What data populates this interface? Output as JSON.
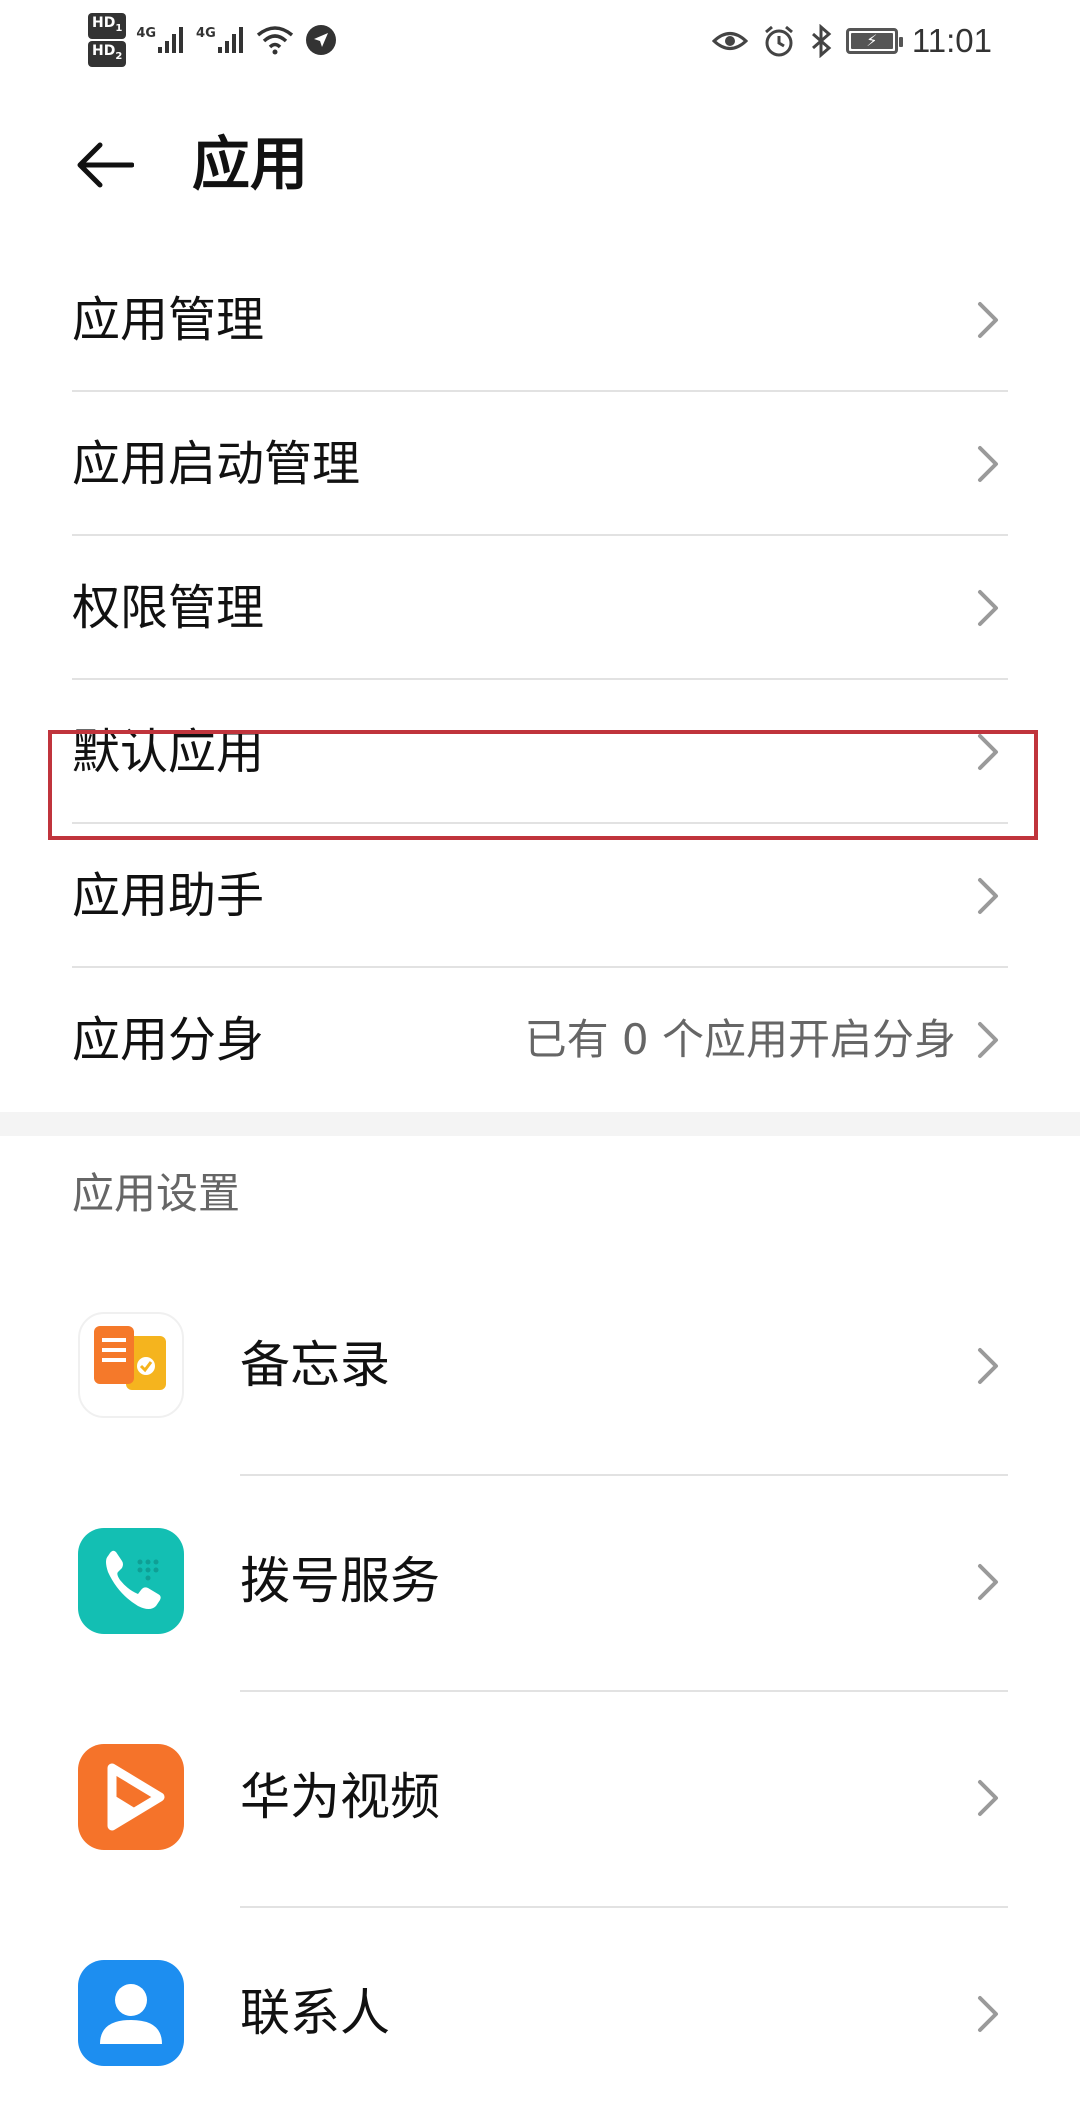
{
  "status_bar": {
    "hd1": "HD",
    "hd1_sub": "1",
    "hd2": "HD",
    "hd2_sub": "2",
    "net1": "4G",
    "net2": "4G",
    "time": "11:01",
    "icons": [
      "eye-icon",
      "alarm-icon",
      "bluetooth-icon",
      "battery-charging-icon",
      "wifi-icon",
      "signal-icon",
      "location-icon"
    ]
  },
  "header": {
    "title": "应用"
  },
  "menu": {
    "items": [
      {
        "label": "应用管理"
      },
      {
        "label": "应用启动管理"
      },
      {
        "label": "权限管理"
      },
      {
        "label": "默认应用"
      },
      {
        "label": "应用助手"
      },
      {
        "label": "应用分身",
        "value": "已有 0 个应用开启分身"
      }
    ]
  },
  "app_settings": {
    "title": "应用设置",
    "apps": [
      {
        "name": "备忘录",
        "icon": "memo-app-icon"
      },
      {
        "name": "拨号服务",
        "icon": "dialer-app-icon"
      },
      {
        "name": "华为视频",
        "icon": "video-app-icon"
      },
      {
        "name": "联系人",
        "icon": "contacts-app-icon"
      }
    ]
  },
  "colors": {
    "highlight_border": "#c0343c",
    "memo_orange": "#f5792a",
    "memo_yellow": "#f5b41e",
    "dialer_teal": "#13bfb3",
    "video_orange": "#f5732a",
    "contacts_blue": "#1d8ef0"
  }
}
